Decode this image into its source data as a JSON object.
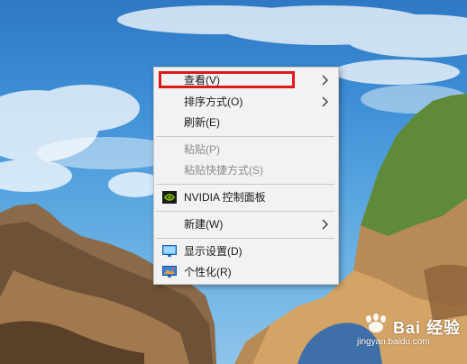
{
  "context_menu": {
    "items": [
      {
        "label": "查看(V)",
        "has_submenu": true,
        "highlighted": true
      },
      {
        "label": "排序方式(O)",
        "has_submenu": true
      },
      {
        "label": "刷新(E)"
      },
      {
        "label": "粘贴(P)",
        "disabled": true
      },
      {
        "label": "粘贴快捷方式(S)",
        "disabled": true
      },
      {
        "label": "NVIDIA 控制面板",
        "icon": "nvidia-icon"
      },
      {
        "label": "新建(W)",
        "has_submenu": true
      },
      {
        "label": "显示设置(D)",
        "icon": "display-settings-icon"
      },
      {
        "label": "个性化(R)",
        "icon": "personalize-icon"
      }
    ]
  },
  "watermark": {
    "brand": "Bai 经验",
    "url": "jingyan.baidu.com"
  },
  "colors": {
    "highlight_border": "#e0191d",
    "menu_background": "#f2f2f2",
    "disabled_text": "#8c8c8c",
    "nvidia_green": "#76b900"
  }
}
